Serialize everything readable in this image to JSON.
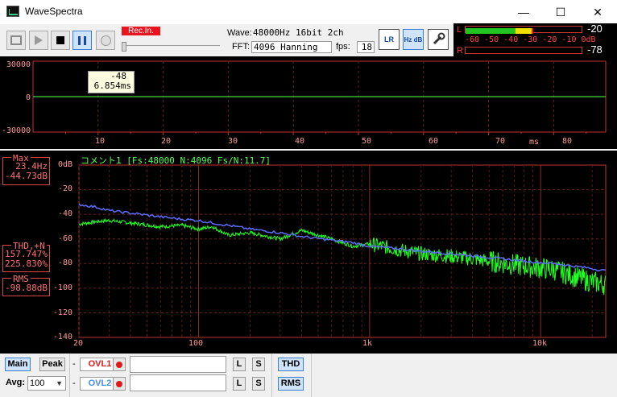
{
  "window": {
    "title": "WaveSpectra",
    "minimize_glyph": "—",
    "maximize_glyph": "☐",
    "close_glyph": "✕"
  },
  "toolbar": {
    "rec_label": "Rec.In.",
    "wave_label": "Wave:",
    "wave_value": "48000Hz 16bit 2ch",
    "fft_label": "FFT:",
    "fft_value": "4096 Hanning",
    "fps_label": "fps:",
    "fps_value": "18",
    "lr_button": "LR",
    "hzdb_button": "Hz dB",
    "icons": [
      "settings-app-icon",
      "play-icon",
      "stop-icon",
      "pause-icon",
      "record-icon",
      "lr-icon",
      "hz-db-icon",
      "wrench-icon"
    ]
  },
  "meter": {
    "left_label": "L",
    "right_label": "R",
    "left_value": "-20",
    "right_value": "-78",
    "scale": "-60 -50 -40 -30 -20 -10  0dB",
    "left_level_db": -20,
    "right_level_db": -78,
    "colors": {
      "green": "#22c422",
      "yellow": "#f0e000",
      "red": "#e01818"
    }
  },
  "waveform": {
    "y_ticks": [
      "30000",
      "0",
      "-30000"
    ],
    "x_ticks": [
      "10",
      "20",
      "30",
      "40",
      "50",
      "60",
      "70",
      "80"
    ],
    "x_unit": "ms",
    "tooltip_value": "-48",
    "tooltip_time": "6.854ms",
    "trace_color": "#3dd63d"
  },
  "spectrum": {
    "header": "コメント1  [Fs:48000 N:4096 Fs/N:11.7]",
    "y_ticks": [
      "0dB",
      "-20",
      "-40",
      "-60",
      "-80",
      "-100",
      "-120",
      "-140"
    ],
    "x_ticks": [
      "20",
      "100",
      "1k",
      "10k"
    ],
    "max_title": "Max",
    "max_freq": "23.4Hz",
    "max_db": "-44.73dB",
    "thd_title": "THD,+N",
    "thd_value": "157.747%",
    "thdn_value": "225.830%",
    "rms_title": "RMS",
    "rms_value": "-98.88dB",
    "trace_colors": {
      "left": "#22ff22",
      "avg": "#5c6cff"
    }
  },
  "chart_data": [
    {
      "type": "line",
      "title": "",
      "xlabel": "ms",
      "ylabel": "",
      "xlim": [
        0,
        88
      ],
      "ylim": [
        -30000,
        30000
      ],
      "series": [
        {
          "x": [
            0,
            88
          ],
          "values": [
            0,
            0
          ]
        }
      ]
    },
    {
      "type": "line",
      "title": "コメント1  [Fs:48000 N:4096 Fs/N:11.7]",
      "xlabel": "",
      "ylabel": "",
      "x_scale": "log",
      "xlim": [
        20,
        24000
      ],
      "ylim": [
        -140,
        0
      ],
      "series": [
        {
          "x": [
            20,
            25,
            30,
            40,
            60,
            80,
            100,
            120,
            150,
            200,
            300,
            400,
            600,
            800,
            1000,
            1500,
            2000,
            3000,
            5000,
            8000,
            12000,
            20000,
            24000
          ],
          "values": [
            -32,
            -34,
            -37,
            -39,
            -42,
            -44,
            -45,
            -47,
            -49,
            -52,
            -55,
            -58,
            -61,
            -63,
            -66,
            -68,
            -70,
            -72,
            -75,
            -78,
            -80,
            -84,
            -86
          ]
        },
        {
          "x": [
            20,
            25,
            30,
            40,
            60,
            80,
            100,
            120,
            150,
            200,
            300,
            400,
            600,
            800,
            1000,
            1500,
            2000,
            3000,
            5000,
            8000,
            12000,
            20000,
            24000
          ],
          "values": [
            -48,
            -46,
            -45,
            -47,
            -50,
            -49,
            -52,
            -50,
            -57,
            -55,
            -60,
            -53,
            -60,
            -66,
            -64,
            -69,
            -72,
            -74,
            -78,
            -82,
            -85,
            -95,
            -97
          ]
        }
      ]
    }
  ],
  "bottom": {
    "main_label": "Main",
    "peak_label": "Peak",
    "avg_label": "Avg:",
    "avg_value": "100",
    "ovl1_label": "OVL1",
    "ovl2_label": "OVL2",
    "dash": "-",
    "l_label": "L",
    "s_label": "S",
    "thd_label": "THD",
    "rms_label": "RMS",
    "ovl1_color": "#e01a1a",
    "ovl2_color": "#4a8ee0"
  }
}
